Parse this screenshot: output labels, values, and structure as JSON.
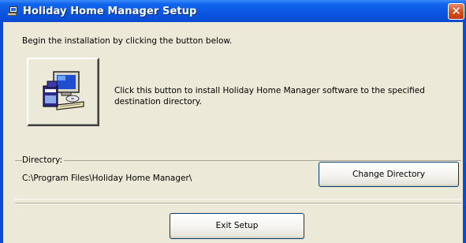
{
  "window": {
    "title": "Holiday Home Manager Setup",
    "close_symbol": "✕"
  },
  "intro_text": "Begin the installation by clicking the button below.",
  "install": {
    "description": "Click this button to install Holiday Home Manager software to the specified destination directory.",
    "icon": "computer-setup-icon"
  },
  "directory": {
    "label": "Directory:",
    "path": "C:\\Program Files\\Holiday Home Manager\\",
    "change_button": "Change Directory"
  },
  "exit_button": "Exit Setup",
  "colors": {
    "title_bar": "#0a56e0",
    "window_bg": "#ece9d8",
    "button_border": "#003c74"
  }
}
